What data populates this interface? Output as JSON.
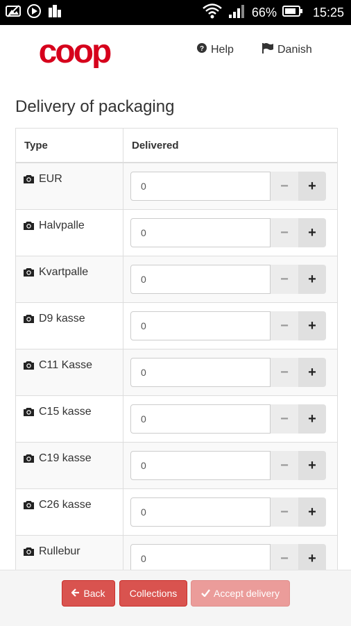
{
  "status_bar": {
    "battery": "66%",
    "time": "15:25"
  },
  "header": {
    "logo": "coop",
    "help_label": "Help",
    "language_label": "Danish"
  },
  "page": {
    "title": "Delivery of packaging"
  },
  "table": {
    "columns": [
      "Type",
      "Delivered"
    ],
    "rows": [
      {
        "type": "EUR",
        "value": "0"
      },
      {
        "type": "Halvpalle",
        "value": "0"
      },
      {
        "type": "Kvartpalle",
        "value": "0"
      },
      {
        "type": "D9 kasse",
        "value": "0"
      },
      {
        "type": "C11 Kasse",
        "value": "0"
      },
      {
        "type": "C15 kasse",
        "value": "0"
      },
      {
        "type": "C19 kasse",
        "value": "0"
      },
      {
        "type": "C26 kasse",
        "value": "0"
      },
      {
        "type": "Rullebur",
        "value": "0"
      }
    ],
    "minus_label": "−",
    "plus_label": "+"
  },
  "footer": {
    "back_label": "Back",
    "collections_label": "Collections",
    "accept_label": "Accept delivery"
  },
  "colors": {
    "brand": "#d6001c",
    "danger": "#d9534f",
    "danger_disabled": "#eb9c9a"
  }
}
